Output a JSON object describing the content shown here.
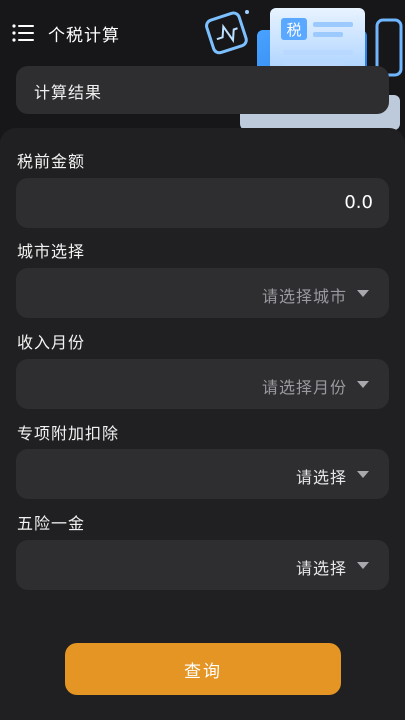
{
  "header": {
    "title": "个税计算",
    "menu_icon": "menu-list-icon",
    "illustration_icon": "tax-document-illustration-icon",
    "illustration_glyph": "税"
  },
  "result": {
    "label": "计算结果"
  },
  "form": {
    "pretax_amount": {
      "label": "税前金额",
      "value": "0.0"
    },
    "city": {
      "label": "城市选择",
      "placeholder": "请选择城市"
    },
    "month": {
      "label": "收入月份",
      "placeholder": "请选择月份"
    },
    "special_deduction": {
      "label": "专项附加扣除",
      "value": "请选择"
    },
    "insurance": {
      "label": "五险一金",
      "value": "请选择"
    }
  },
  "actions": {
    "query_label": "查询"
  },
  "colors": {
    "background": "#1f1f21",
    "field": "#2e2e31",
    "accent": "#e59524"
  }
}
